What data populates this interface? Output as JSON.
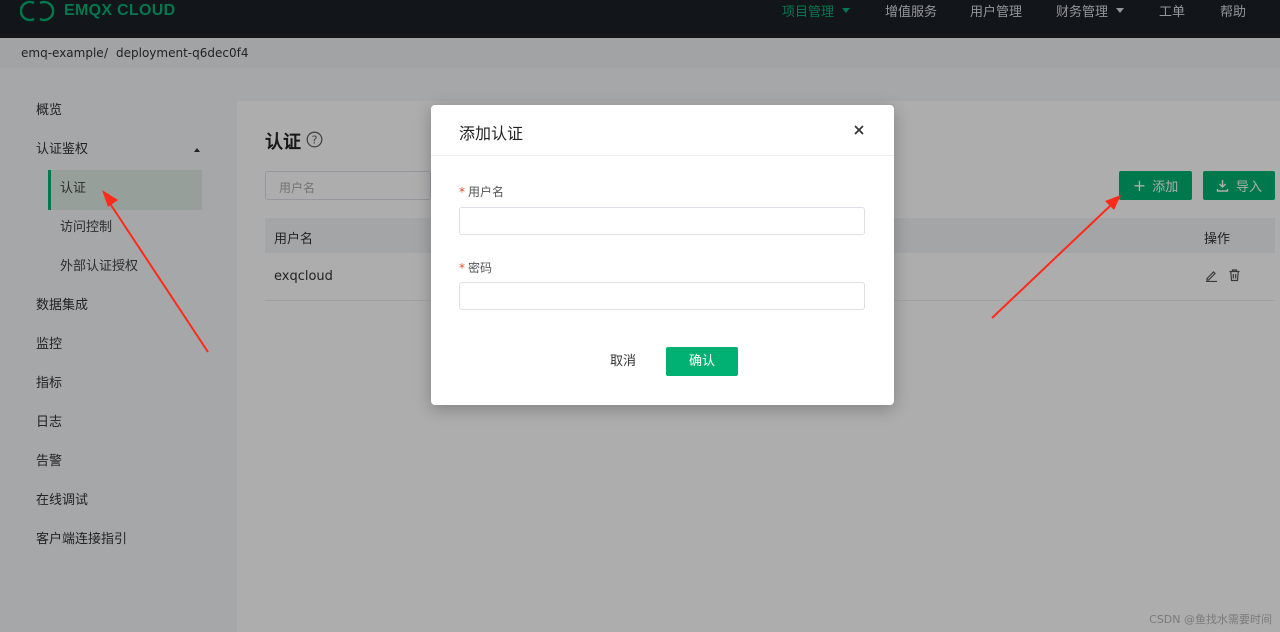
{
  "header": {
    "logo_text": "EMQX CLOUD",
    "nav": [
      {
        "label": "项目管理",
        "active": true,
        "has_caret": true
      },
      {
        "label": "增值服务"
      },
      {
        "label": "用户管理"
      },
      {
        "label": "财务管理",
        "has_caret": true
      },
      {
        "label": "工单"
      },
      {
        "label": "帮助"
      }
    ]
  },
  "breadcrumb": [
    "emq-example",
    "/",
    "deployment-q6dec0f4"
  ],
  "sidebar": {
    "items": [
      "概览",
      "认证鉴权",
      "数据集成",
      "监控",
      "指标",
      "日志",
      "告警",
      "在线调试",
      "客户端连接指引"
    ],
    "subitems": [
      "认证",
      "访问控制",
      "外部认证授权"
    ],
    "active_subitem": "认证"
  },
  "page": {
    "title": "认证",
    "search_placeholder": "用户名",
    "add_button": "添加",
    "import_button": "导入",
    "table": {
      "headers": [
        "用户名",
        "操作"
      ],
      "rows": [
        {
          "username": "exqcloud"
        }
      ]
    }
  },
  "modal": {
    "title": "添加认证",
    "username_label": "用户名",
    "password_label": "密码",
    "required_mark": "*",
    "cancel_label": "取消",
    "ok_label": "确认"
  },
  "watermark": "CSDN @鱼找水需要时间",
  "colors": {
    "accent": "#00b173",
    "topbar": "#1b1f27",
    "annotation": "#ff2a1a"
  }
}
